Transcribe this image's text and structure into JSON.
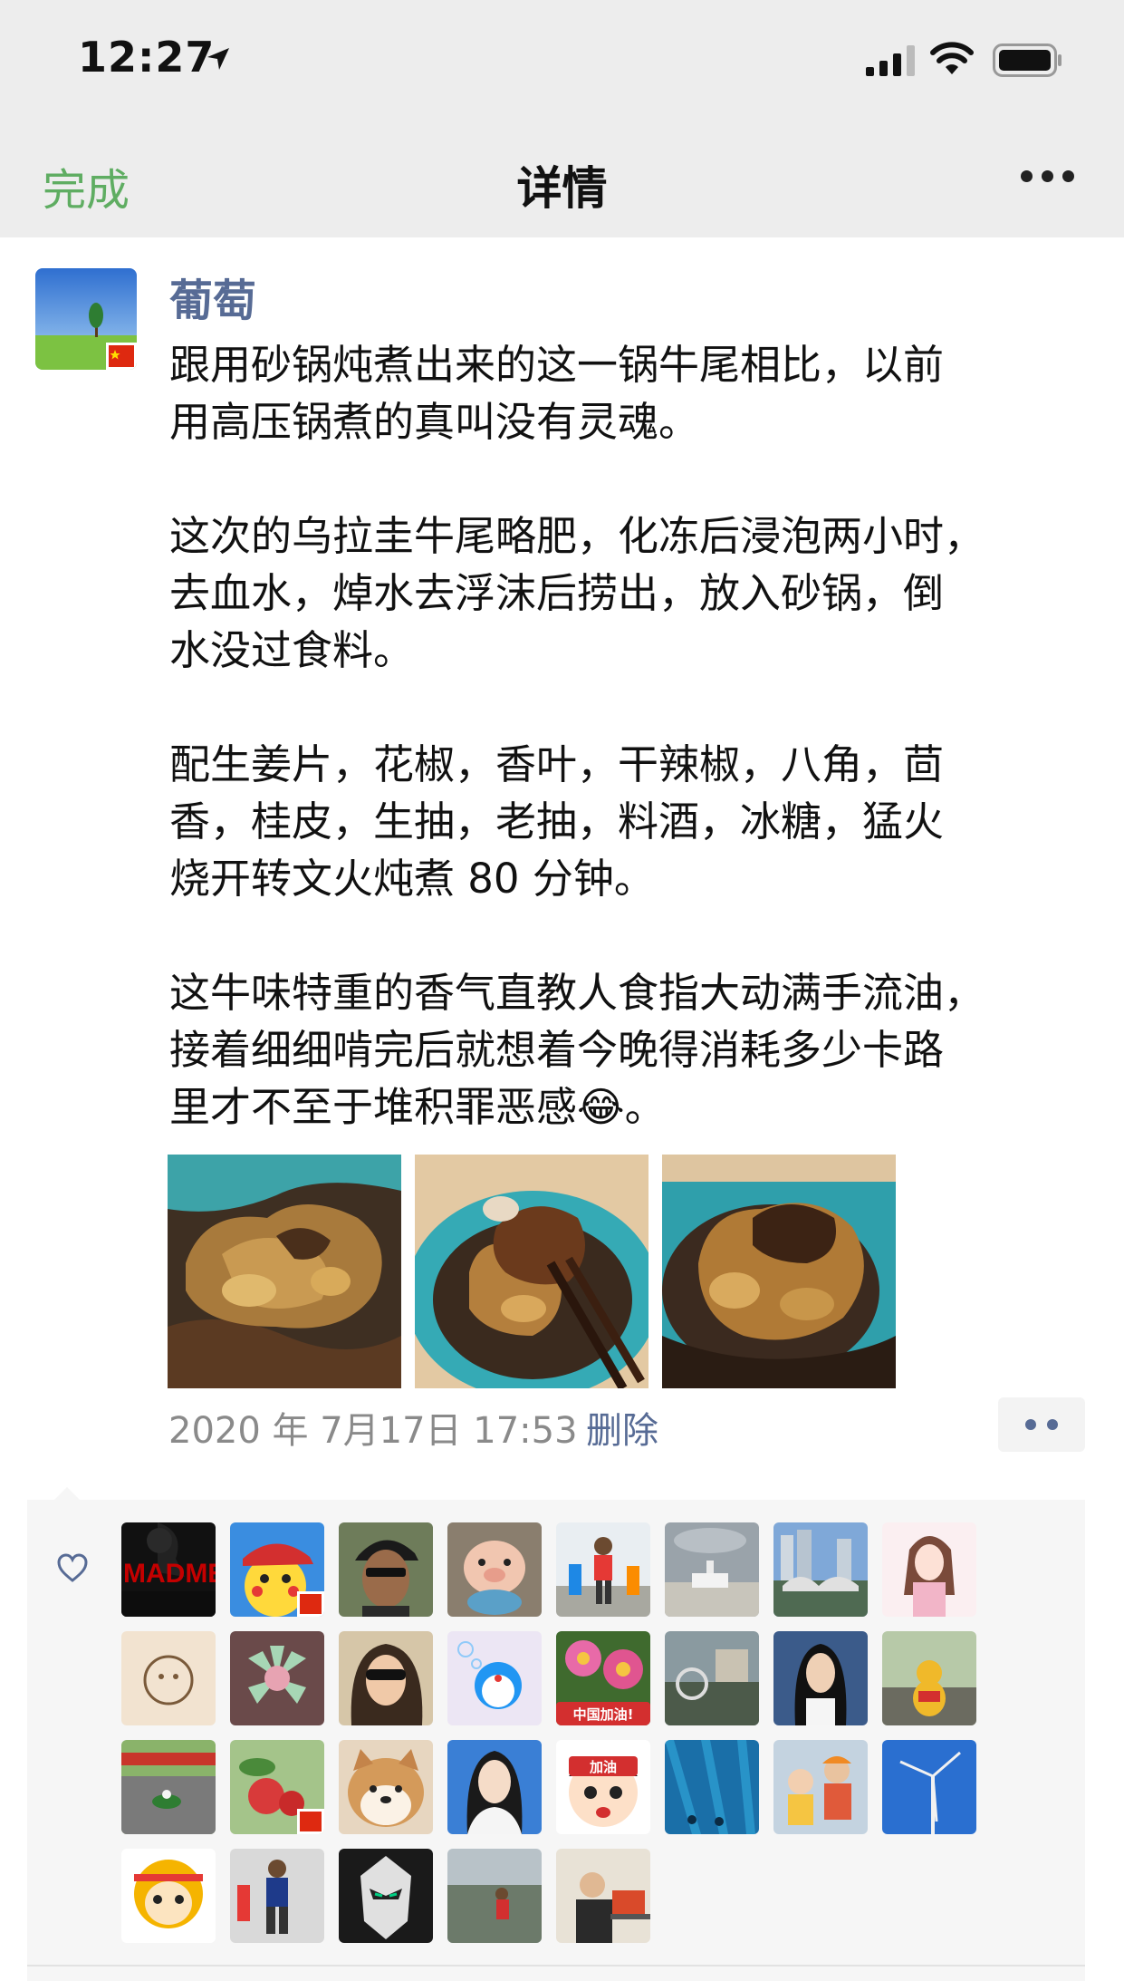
{
  "status_bar": {
    "time": "12:27"
  },
  "nav": {
    "done_label": "完成",
    "title": "详情"
  },
  "post": {
    "username": "葡萄",
    "text": "跟用砂锅炖煮出来的这一锅牛尾相比，以前\n用高压锅煮的真叫没有灵魂。\n\n这次的乌拉圭牛尾略肥，化冻后浸泡两小时，\n去血水，焯水去浮沫后捞出，放入砂锅，倒\n水没过食料。\n\n配生姜片，花椒，香叶，干辣椒，八角，茴\n香，桂皮，生抽，老抽，料酒，冰糖，猛火\n烧开转文火炖煮 80 分钟。\n\n这牛味特重的香气直教人食指大动满手流油，\n接着细细啃完后就想着今晚得消耗多少卡路\n里才不至于堆积罪恶感😂。",
    "timestamp": "2020 年 7月17日 17:53",
    "delete_label": "删除"
  },
  "likes": {
    "avatars": [
      {
        "name": "like-avatar-1",
        "label": "MADME"
      },
      {
        "name": "like-avatar-2"
      },
      {
        "name": "like-avatar-3"
      },
      {
        "name": "like-avatar-4"
      },
      {
        "name": "like-avatar-5"
      },
      {
        "name": "like-avatar-6"
      },
      {
        "name": "like-avatar-7"
      },
      {
        "name": "like-avatar-8"
      },
      {
        "name": "like-avatar-9"
      },
      {
        "name": "like-avatar-10"
      },
      {
        "name": "like-avatar-11"
      },
      {
        "name": "like-avatar-12"
      },
      {
        "name": "like-avatar-13",
        "label": "中国加油!"
      },
      {
        "name": "like-avatar-14"
      },
      {
        "name": "like-avatar-15"
      },
      {
        "name": "like-avatar-16"
      },
      {
        "name": "like-avatar-17"
      },
      {
        "name": "like-avatar-18"
      },
      {
        "name": "like-avatar-19"
      },
      {
        "name": "like-avatar-20"
      },
      {
        "name": "like-avatar-21",
        "label": "加油"
      },
      {
        "name": "like-avatar-22"
      },
      {
        "name": "like-avatar-23"
      },
      {
        "name": "like-avatar-24"
      },
      {
        "name": "like-avatar-25"
      },
      {
        "name": "like-avatar-26"
      },
      {
        "name": "like-avatar-27"
      },
      {
        "name": "like-avatar-28"
      },
      {
        "name": "like-avatar-29"
      }
    ]
  },
  "colors": {
    "accent_green": "#5fad62",
    "link_blue": "#576b95",
    "bar_bg": "#ededed"
  }
}
